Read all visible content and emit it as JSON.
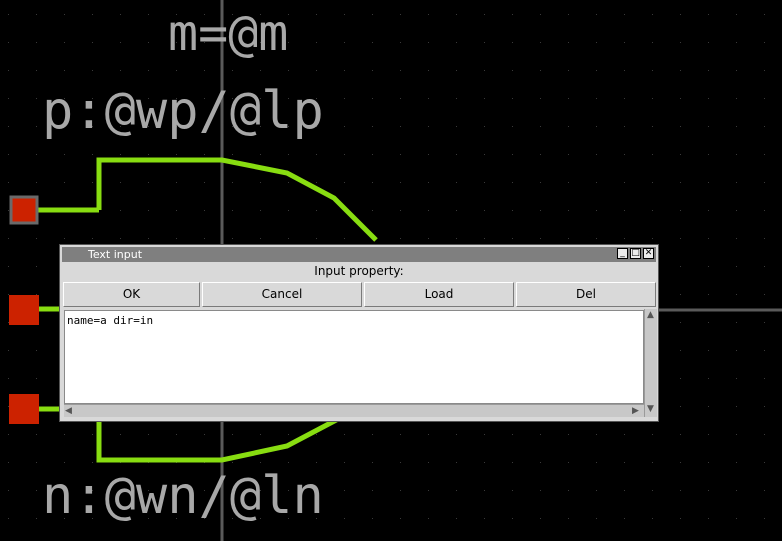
{
  "schematic": {
    "label_m": "m=@m",
    "label_p": "p:@wp/@lp",
    "label_n": "n:@wn/@ln",
    "colors": {
      "background": "#000000",
      "grid_axis": "#5a5a5a",
      "wire": "#88dd11",
      "pin": "#cc2200",
      "text": "#a8a8a8"
    }
  },
  "dialog": {
    "title": "Text input",
    "prompt": "Input property:",
    "buttons": {
      "ok": "OK",
      "cancel": "Cancel",
      "load": "Load",
      "del": "Del"
    },
    "text_value": "name=a dir=in",
    "window_controls": {
      "minimize": "_",
      "maximize": "□",
      "close": "✕"
    }
  }
}
